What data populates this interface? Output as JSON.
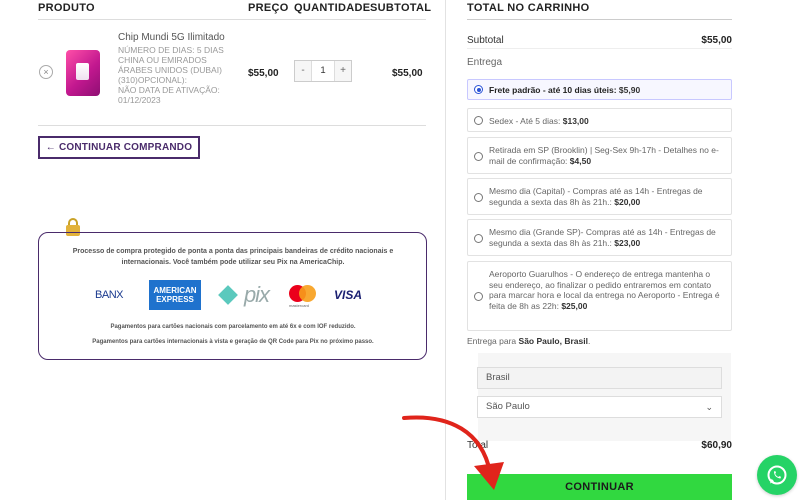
{
  "cart_table": {
    "headers": [
      "PRODUTO",
      "PREÇO",
      "QUANTIDADE",
      "SUBTOTAL"
    ],
    "item": {
      "remove_glyph": "×",
      "name": "Chip Mundi 5G Ilimitado",
      "meta": [
        "NÚMERO DE DIAS:  5 DIAS",
        "CHINA OU EMIRADOS ÁRABES UNIDOS (DUBAI) (310)OPCIONAL):",
        "NÃO  DATA DE ATIVAÇÃO:",
        "01/12/2023"
      ],
      "price": "$55,00",
      "quantity": "1",
      "qty_minus": "-",
      "qty_plus": "+",
      "subtotal": "$55,00"
    },
    "continue_label": "← CONTINUAR COMPRANDO"
  },
  "secure_box": {
    "text_top": "Processo de compra protegido de ponta a ponta das principais bandeiras de crédito nacionais e internacionais. Você também pode utilizar seu Pix na AmericaChip.",
    "payment_logos": {
      "banx": "BANX",
      "amex_line1": "AMERICAN",
      "amex_line2": "EXPRESS",
      "pix": "pix",
      "mastercard": "mastercard",
      "visa": "VISA"
    },
    "text_national": "Pagamentos para cartões nacionais com parcelamento em até 6x e com IOF reduzido.",
    "text_international": "Pagamentos para cartões internacionais à vista e geração de QR Code para Pix no próximo passo."
  },
  "totals": {
    "title": "TOTAL NO CARRINHO",
    "subtotal_label": "Subtotal",
    "subtotal_value": "$55,00",
    "shipping_label": "Entrega",
    "shipping_options": [
      {
        "text": "Frete padrão - até 10 dias úteis:",
        "price": "$5,90",
        "selected": true
      },
      {
        "text": "Sedex - Até 5 dias:",
        "price": "$13,00",
        "selected": false
      },
      {
        "text": "Retirada em SP (Brooklin) | Seg-Sex 9h-17h - Detalhes no e-mail de confirmação:",
        "price": "$4,50",
        "selected": false
      },
      {
        "text": "Mesmo dia (Capital) - Compras até as 14h - Entregas de segunda a sexta das 8h às 21h.:",
        "price": "$20,00",
        "selected": false
      },
      {
        "text": "Mesmo dia (Grande SP)- Compras até as 14h - Entregas de segunda a sexta das 8h às 21h.:",
        "price": "$23,00",
        "selected": false
      },
      {
        "text": "Aeroporto Guarulhos - O endereço de entrega mantenha o seu endereço, ao finalizar o pedido entraremos em contato para marcar hora e local da entrega no Aeroporto - Entrega é feita de 8h as 22h:",
        "price": "$25,00",
        "selected": false
      }
    ],
    "destination_prefix": "Entrega para",
    "destination_value": "São Paulo, Brasil",
    "destination_suffix": ".",
    "country_value": "Brasil",
    "state_value": "São Paulo",
    "total_label": "Total",
    "total_value": "$60,90",
    "checkout_label": "CONTINUAR"
  },
  "icons": {
    "whatsapp": "whatsapp-icon",
    "lock": "lock-icon",
    "arrow": "red-arrow-annotation"
  },
  "colors": {
    "brand_purple": "#4a2b6b",
    "checkout_green": "#31d840",
    "whatsapp_green": "#25d366",
    "annotation_red": "#e0241b"
  }
}
